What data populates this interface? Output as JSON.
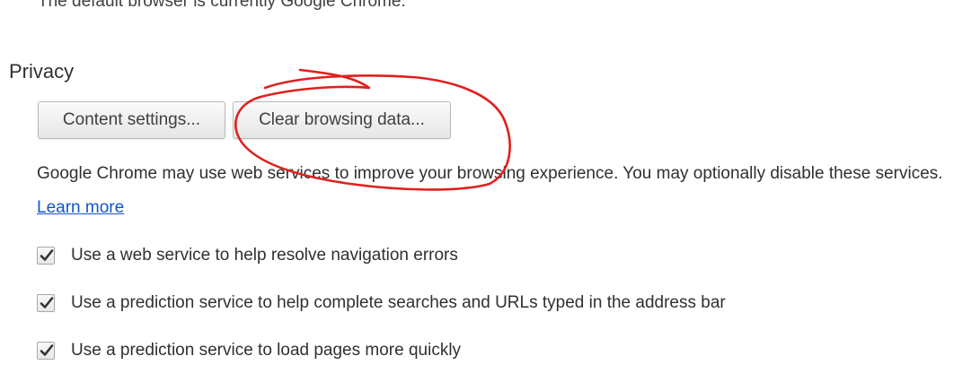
{
  "header": {
    "partial_text": "The default browser is currently Google Chrome."
  },
  "privacy": {
    "title": "Privacy",
    "buttons": {
      "content_settings": "Content settings...",
      "clear_browsing_data": "Clear browsing data..."
    },
    "description": "Google Chrome may use web services to improve your browsing experience. You may optionally disable these services.",
    "learn_more": "Learn more",
    "options": [
      {
        "label": "Use a web service to help resolve navigation errors",
        "checked": true
      },
      {
        "label": "Use a prediction service to help complete searches and URLs typed in the address bar",
        "checked": true
      },
      {
        "label": "Use a prediction service to load pages more quickly",
        "checked": true
      }
    ]
  },
  "annotation": {
    "color": "#e0201e",
    "icon": "hand-drawn-circle"
  },
  "colors": {
    "link": "#1155cc",
    "text": "#303030"
  }
}
